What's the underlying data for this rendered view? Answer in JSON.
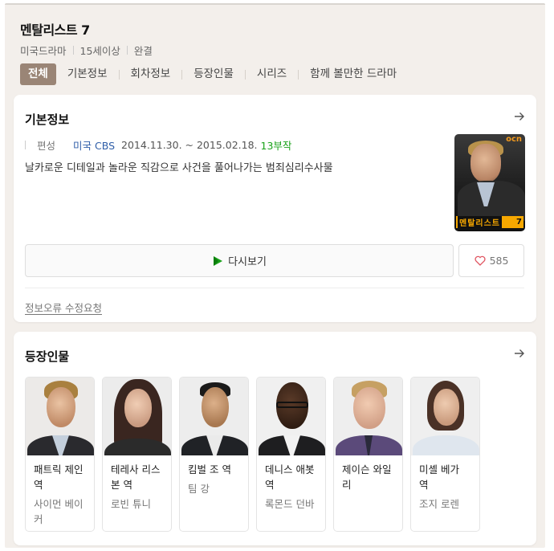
{
  "show": {
    "title": "멘탈리스트 7",
    "meta": [
      "미국드라마",
      "15세이상",
      "완결"
    ]
  },
  "tabs": [
    {
      "label": "전체",
      "active": true
    },
    {
      "label": "기본정보"
    },
    {
      "label": "회차정보"
    },
    {
      "label": "등장인물"
    },
    {
      "label": "시리즈"
    },
    {
      "label": "함께 볼만한 드라마"
    }
  ],
  "basic_info": {
    "section_title": "기본정보",
    "row_label": "편성",
    "network": "미국 CBS",
    "dates": "2014.11.30. ~ 2015.02.18.",
    "episodes": "13부작",
    "description": "날카로운 디테일과 놀라운 직감으로 사건을 풀어나가는 범죄심리수사물",
    "poster": {
      "channel_logo": "ocn",
      "title_text": "멘탈리스트",
      "number": "7"
    },
    "watch_button": "다시보기",
    "like_count": "585",
    "report_link": "정보오류 수정요청",
    "accent_color": "#1aa21a"
  },
  "cast_section": {
    "section_title": "등장인물",
    "members": [
      {
        "role": "패트릭 제인 역",
        "actor": "사이먼 베이커"
      },
      {
        "role": "테레사 리스본 역",
        "actor": "로빈 튜니"
      },
      {
        "role": "킴벌 조 역",
        "actor": "팀 강"
      },
      {
        "role": "데니스 애봇 역",
        "actor": "록몬드 던바"
      },
      {
        "role": "제이슨 와일리",
        "actor": ""
      },
      {
        "role": "미셸 베가 역",
        "actor": "조지 로렌"
      }
    ]
  }
}
